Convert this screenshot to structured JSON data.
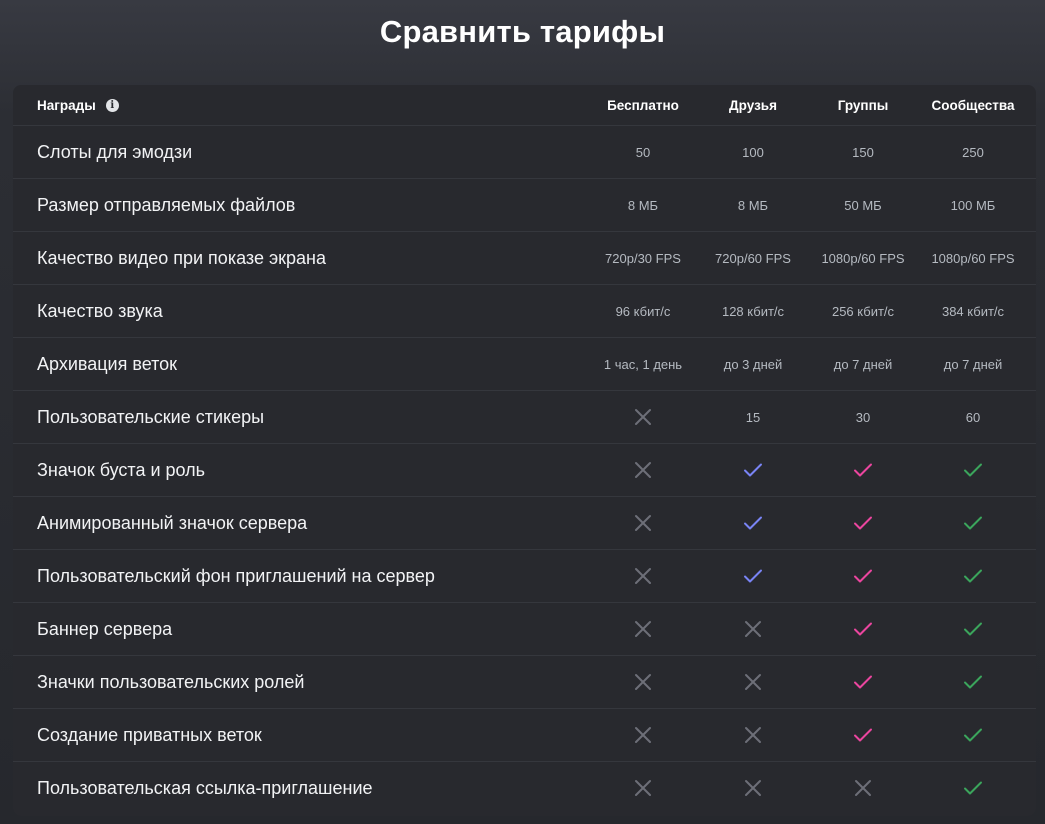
{
  "title": "Сравнить тарифы",
  "header": {
    "rewards_label": "Награды",
    "plans": [
      "Бесплатно",
      "Друзья",
      "Группы",
      "Сообщества"
    ]
  },
  "colors": {
    "cross": "#6d6f78",
    "check_friends": "#7984f5",
    "check_groups": "#eb459f",
    "check_communities": "#3ba55c"
  },
  "rows": [
    {
      "label": "Слоты для эмодзи",
      "values": [
        "50",
        "100",
        "150",
        "250"
      ]
    },
    {
      "label": "Размер отправляемых файлов",
      "values": [
        "8 МБ",
        "8 МБ",
        "50 МБ",
        "100 МБ"
      ]
    },
    {
      "label": "Качество видео при показе экрана",
      "values": [
        "720p/30 FPS",
        "720p/60 FPS",
        "1080p/60 FPS",
        "1080p/60 FPS"
      ]
    },
    {
      "label": "Качество звука",
      "values": [
        "96 кбит/с",
        "128 кбит/с",
        "256 кбит/с",
        "384 кбит/с"
      ]
    },
    {
      "label": "Архивация веток",
      "values": [
        "1 час, 1 день",
        "до 3 дней",
        "до 7 дней",
        "до 7 дней"
      ]
    },
    {
      "label": "Пользовательские стикеры",
      "values": [
        "cross",
        "15",
        "30",
        "60"
      ]
    },
    {
      "label": "Значок буста и роль",
      "values": [
        "cross",
        "check",
        "check",
        "check"
      ]
    },
    {
      "label": "Анимированный значок сервера",
      "values": [
        "cross",
        "check",
        "check",
        "check"
      ]
    },
    {
      "label": "Пользовательский фон приглашений на сервер",
      "values": [
        "cross",
        "check",
        "check",
        "check"
      ]
    },
    {
      "label": "Баннер сервера",
      "values": [
        "cross",
        "cross",
        "check",
        "check"
      ]
    },
    {
      "label": "Значки пользовательских ролей",
      "values": [
        "cross",
        "cross",
        "check",
        "check"
      ]
    },
    {
      "label": "Создание приватных веток",
      "values": [
        "cross",
        "cross",
        "check",
        "check"
      ]
    },
    {
      "label": "Пользовательская ссылка-приглашение",
      "values": [
        "cross",
        "cross",
        "cross",
        "check"
      ]
    }
  ]
}
